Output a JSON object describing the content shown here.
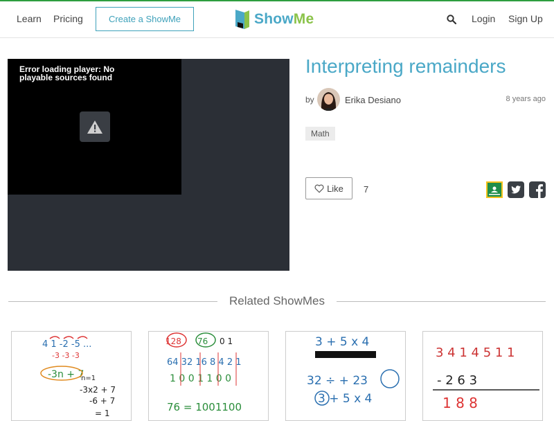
{
  "nav": {
    "learn": "Learn",
    "pricing": "Pricing",
    "create": "Create a ShowMe",
    "logo_show": "Show",
    "logo_me": "Me",
    "login": "Login",
    "signup": "Sign Up"
  },
  "player": {
    "error_message": "Error loading player: No playable sources found"
  },
  "video": {
    "title": "Interpreting remainders",
    "by": "by",
    "author": "Erika Desiano",
    "posted": "8 years ago",
    "tag": "Math",
    "like_label": "Like",
    "like_count": "7"
  },
  "share_icons": [
    "google-classroom-icon",
    "twitter-icon",
    "facebook-icon"
  ],
  "related": {
    "title": "Related ShowMes",
    "thumbs": [
      {
        "lines": [
          "4 1 -2 -5 ...",
          "-3 -3 -3",
          "-3n + 7",
          "n=1",
          "-3x2 + 7",
          "-6 + 7",
          "= 1"
        ]
      },
      {
        "lines": [
          "128",
          "76",
          "0 1",
          "64 32 16 8 4 2 1",
          "1 0 0 1 1 0 0",
          "76 = 1001100"
        ]
      },
      {
        "lines": [
          "3 + 5 x 4",
          "32 ÷ + 23",
          "3 + 5 x 4"
        ]
      },
      {
        "lines": [
          "3 4 1 4 5 1 1",
          "- 2 6 3",
          "1 8 8"
        ]
      }
    ]
  },
  "colors": {
    "brand_blue": "#4aa8c7",
    "brand_green": "#8bc34a",
    "top_accent": "#2e9e3f"
  }
}
